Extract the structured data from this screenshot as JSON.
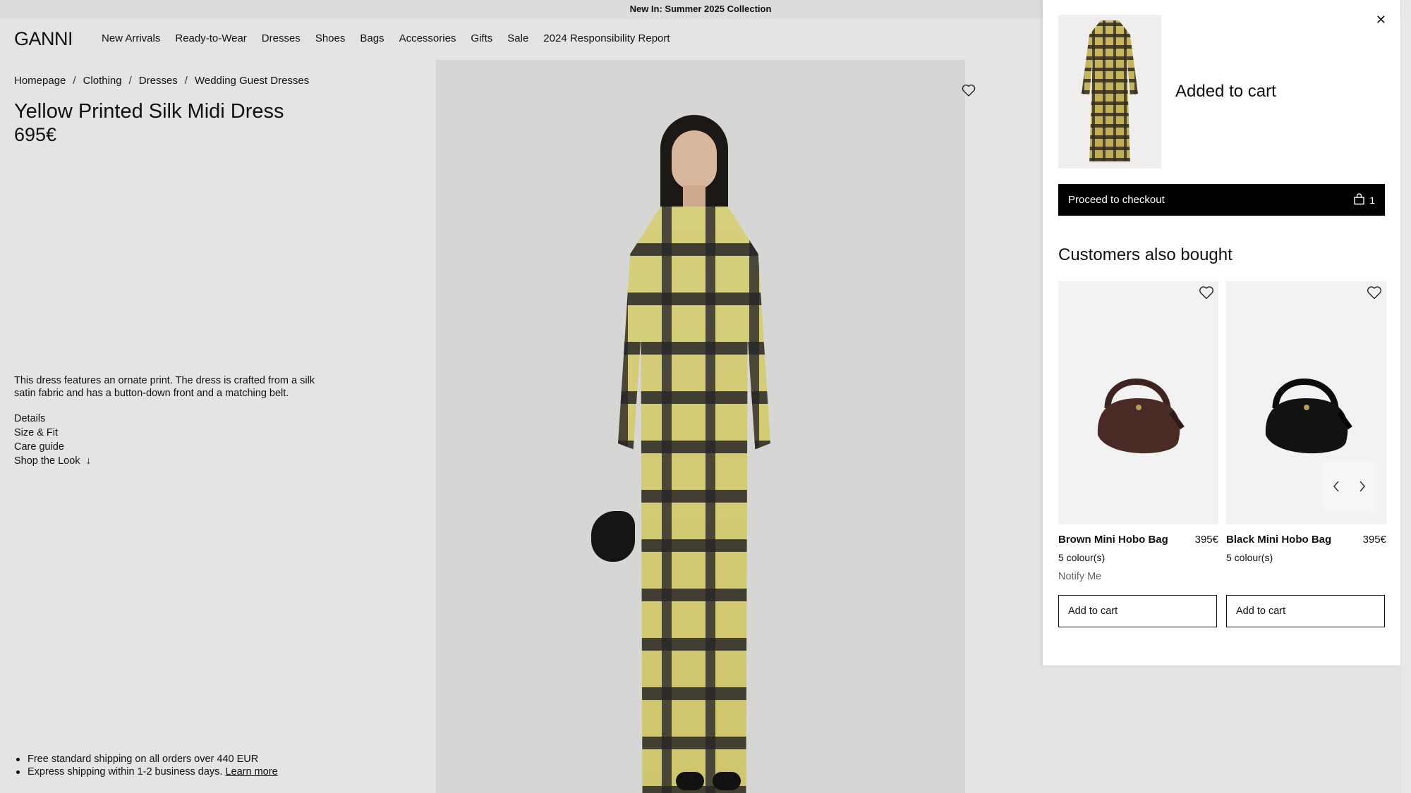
{
  "promo": {
    "text": "New In: Summer 2025 Collection"
  },
  "header": {
    "logo": "GANNI",
    "nav": [
      "New Arrivals",
      "Ready-to-Wear",
      "Dresses",
      "Shoes",
      "Bags",
      "Accessories",
      "Gifts",
      "Sale",
      "2024 Responsibility Report"
    ]
  },
  "breadcrumb": {
    "items": [
      "Homepage",
      "Clothing",
      "Dresses",
      "Wedding Guest Dresses"
    ],
    "separator": "/"
  },
  "product": {
    "title": "Yellow Printed Silk Midi Dress",
    "price": "695€",
    "description": "This dress features an ornate print. The dress is crafted from a silk satin fabric and has a button-down front and a matching belt.",
    "links": [
      "Details",
      "Size & Fit",
      "Care guide",
      "Shop the Look"
    ],
    "shop_the_look_arrow": "↓",
    "wishlist_icon": "heart-icon"
  },
  "shipping": {
    "line1": "Free standard shipping on all orders over 440 EUR",
    "line2": "Express shipping within 1-2 business days.",
    "learn_more": "Learn more"
  },
  "cart_drawer": {
    "close_icon": "close-icon",
    "close_glyph": "✕",
    "added_label": "Added to cart",
    "checkout_label": "Proceed to checkout",
    "cart_count": "1",
    "section_title": "Customers also bought",
    "recommendations": [
      {
        "name": "Brown Mini Hobo Bag",
        "price": "395€",
        "colours": "5 colour(s)",
        "notify": "Notify Me",
        "add_label": "Add to cart",
        "color": "#4a2a25"
      },
      {
        "name": "Black Mini Hobo Bag",
        "price": "395€",
        "colours": "5 colour(s)",
        "notify": "",
        "add_label": "Add to cart",
        "color": "#121212"
      }
    ]
  },
  "colors": {
    "drawer_bg": "#ffffff",
    "checkout_bg": "#000000",
    "page_bg": "#e4e4e4"
  }
}
